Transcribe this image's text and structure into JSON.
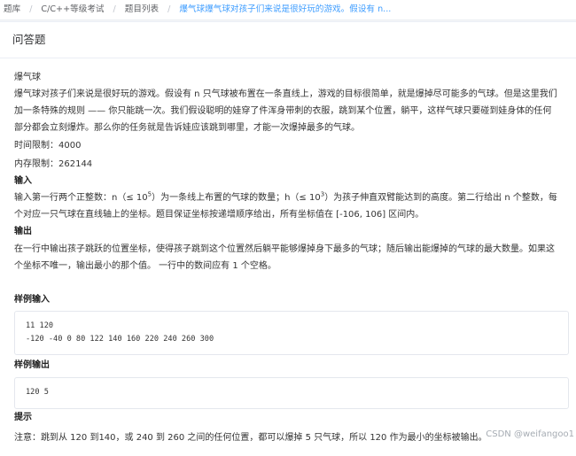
{
  "breadcrumb": {
    "items": [
      "题库",
      "C/C++等级考试",
      "题目列表"
    ],
    "current": "爆气球爆气球对孩子们来说是很好玩的游戏。假设有 n..."
  },
  "card": {
    "header": "问答题"
  },
  "problem": {
    "title": "爆气球",
    "desc_line1": "爆气球对孩子们来说是很好玩的游戏。假设有 n 只气球被布置在一条直线上，游戏的目标很简单，就是爆掉尽可能多的气球。但是这里我们",
    "desc_line2": "加一条特殊的规则 —— 你只能跳一次。我们假设聪明的娃穿了件浑身带刺的衣服，跳到某个位置，躺平，这样气球只要碰到娃身体的任何",
    "desc_line3": "部分都会立刻爆炸。那么你的任务就是告诉娃应该跳到哪里，才能一次爆掉最多的气球。",
    "time_limit_label": "时间限制：",
    "time_limit": "4000",
    "mem_limit_label": "内存限制：",
    "mem_limit": "262144",
    "input_heading": "输入",
    "input_p1": "输入第一行两个正整数：n（≤ 10",
    "input_exp1": "5",
    "input_p2": "）为一条线上布置的气球的数量；h（≤ 10",
    "input_exp2": "3",
    "input_p3": "）为孩子伸直双臂能达到的高度。第二行给出 n 个整数，每",
    "input_line2": "个对应一只气球在直线轴上的坐标。题目保证坐标按递增顺序给出，所有坐标值在 [-106, 106] 区间内。",
    "output_heading": "输出",
    "output_line1": "在一行中输出孩子跳跃的位置坐标，使得孩子跳到这个位置然后躺平能够爆掉身下最多的气球；随后输出能爆掉的气球的最大数量。如果这",
    "output_line2": "个坐标不唯一，输出最小的那个值。 一行中的数间应有 1 个空格。",
    "sample_input_heading": "样例输入",
    "sample_input_line1": "11 120",
    "sample_input_line2": "-120 -40 0 80 122 140 160 220 240 260 300",
    "sample_output_heading": "样例输出",
    "sample_output_line1": "120 5",
    "hint_heading": "提示",
    "hint_line": "注意：跳到从 120 到140，或 240 到 260 之间的任何位置，都可以爆掉 5 只气球，所以 120 作为最小的坐标被输出。"
  },
  "watermark": "CSDN @weifangoo1"
}
